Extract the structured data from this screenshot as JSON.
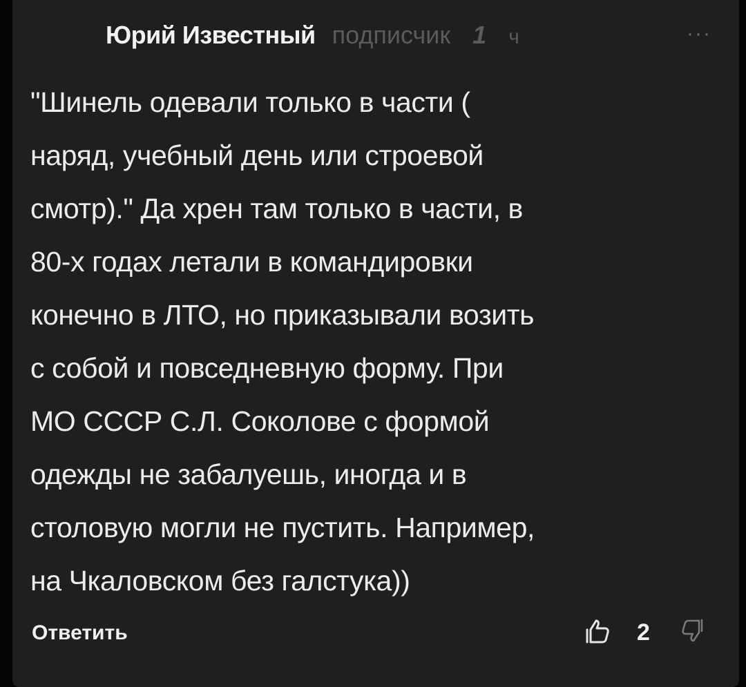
{
  "comment": {
    "author": "Юрий Известный",
    "role": "подписчик",
    "time_value": "1",
    "time_unit": "ч",
    "more_label": "···",
    "text": "\"Шинель одевали только в части (\nнаряд, учебный день или строевой\nсмотр).\" Да хрен там только в части,  в\n80-х годах  летали в командировки\nконечно в ЛТО, но приказывали возить\nс собой и повседневную форму. При\nМО СССР С.Л. Соколове с формой\nодежды  не забалуешь, иногда и в\nстоловую могли не пустить. Например,\nна Чкаловском без галстука))"
  },
  "actions": {
    "reply_label": "Ответить",
    "like_count": "2",
    "like_icon": "thumb-up-outline",
    "dislike_icon": "thumb-down-outline"
  },
  "colors": {
    "background": "#050505",
    "card": "#1f1f1f",
    "text": "#ececec",
    "muted": "#5b5b5b"
  }
}
